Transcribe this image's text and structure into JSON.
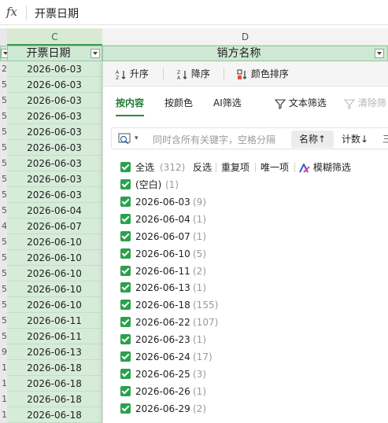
{
  "formula_bar": {
    "fx_label": "fx",
    "content": "开票日期"
  },
  "column_headers": {
    "c": "C",
    "d": "D"
  },
  "filter_headers": {
    "c": "开票日期",
    "d": "销方名称"
  },
  "rows": [
    {
      "num": "2",
      "date": "2026-06-03"
    },
    {
      "num": "5",
      "date": "2026-06-03"
    },
    {
      "num": "5",
      "date": "2026-06-03"
    },
    {
      "num": "5",
      "date": "2026-06-03"
    },
    {
      "num": "5",
      "date": "2026-06-03"
    },
    {
      "num": "5",
      "date": "2026-06-03"
    },
    {
      "num": "5",
      "date": "2026-06-03"
    },
    {
      "num": "5",
      "date": "2026-06-03"
    },
    {
      "num": "5",
      "date": "2026-06-03"
    },
    {
      "num": "5",
      "date": "2026-06-04"
    },
    {
      "num": "4",
      "date": "2026-06-07"
    },
    {
      "num": "5",
      "date": "2026-06-10"
    },
    {
      "num": "5",
      "date": "2026-06-10"
    },
    {
      "num": "5",
      "date": "2026-06-10"
    },
    {
      "num": "5",
      "date": "2026-06-10"
    },
    {
      "num": "5",
      "date": "2026-06-10"
    },
    {
      "num": "5",
      "date": "2026-06-11"
    },
    {
      "num": "5",
      "date": "2026-06-11"
    },
    {
      "num": "9",
      "date": "2026-06-13"
    },
    {
      "num": "1",
      "date": "2026-06-18"
    },
    {
      "num": "1",
      "date": "2026-06-18"
    },
    {
      "num": "1",
      "date": "2026-06-18"
    },
    {
      "num": "1",
      "date": "2026-06-18"
    }
  ],
  "sort_bar": {
    "asc": "升序",
    "desc": "降序",
    "color": "颜色排序"
  },
  "tabs": {
    "by_content": "按内容",
    "by_color": "按颜色",
    "ai": "AI筛选",
    "text_filter": "文本筛选",
    "clear": "清除筛"
  },
  "search": {
    "placeholder": "同时含所有关键字，空格分隔",
    "sort_name": "名称↑",
    "sort_count": "计数↓",
    "more": "三"
  },
  "first_line": {
    "select_all": "全选",
    "total": "(312)",
    "invert": "反选",
    "dup": "重复项",
    "unique": "唯一项",
    "fuzzy": "模糊筛选"
  },
  "items": [
    {
      "label": "(空白)",
      "count": "(1)"
    },
    {
      "label": "2026-06-03",
      "count": "(9)"
    },
    {
      "label": "2026-06-04",
      "count": "(1)"
    },
    {
      "label": "2026-06-07",
      "count": "(1)"
    },
    {
      "label": "2026-06-10",
      "count": "(5)"
    },
    {
      "label": "2026-06-11",
      "count": "(2)"
    },
    {
      "label": "2026-06-13",
      "count": "(1)"
    },
    {
      "label": "2026-06-18",
      "count": "(155)"
    },
    {
      "label": "2026-06-22",
      "count": "(107)"
    },
    {
      "label": "2026-06-23",
      "count": "(1)"
    },
    {
      "label": "2026-06-24",
      "count": "(17)"
    },
    {
      "label": "2026-06-25",
      "count": "(3)"
    },
    {
      "label": "2026-06-26",
      "count": "(1)"
    },
    {
      "label": "2026-06-29",
      "count": "(2)"
    }
  ],
  "colors": {
    "accent": "#2aa14a",
    "header_fill": "#cfe8d4",
    "row_fill": "#d6ecd9"
  }
}
